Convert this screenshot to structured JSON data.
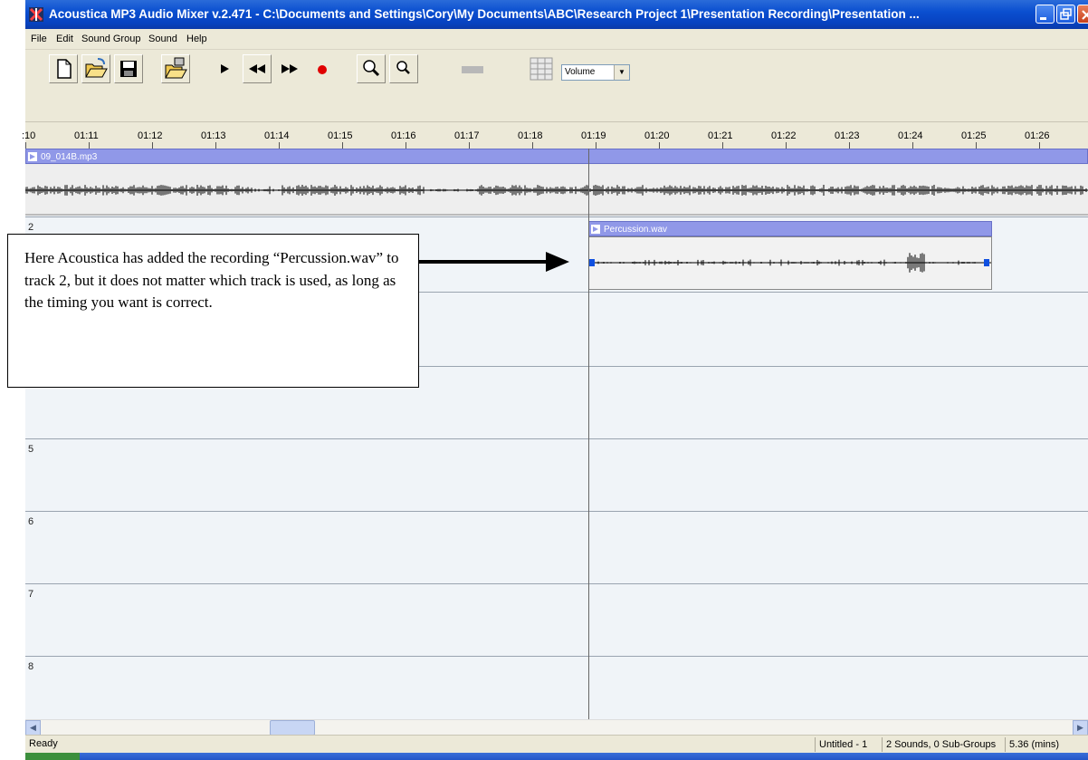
{
  "window": {
    "title": "Acoustica MP3 Audio Mixer v.2.471 - C:\\Documents and Settings\\Cory\\My Documents\\ABC\\Research Project 1\\Presentation Recording\\Presentation ..."
  },
  "menu": [
    "File",
    "Edit",
    "Sound Group",
    "Sound",
    "Help"
  ],
  "toolbar": {
    "buttons": [
      "new-file-icon",
      "open-folder-icon",
      "save-icon",
      "open-project-icon",
      "play-icon",
      "rewind-icon",
      "fast-forward-icon",
      "record-icon",
      "zoom-in-icon",
      "zoom-out-icon",
      "mute-icon",
      "grid-icon"
    ],
    "volume_label": "Volume"
  },
  "ruler": {
    "ticks": [
      ":10",
      "01:11",
      "01:12",
      "01:13",
      "01:14",
      "01:15",
      "01:16",
      "01:17",
      "01:18",
      "01:19",
      "01:20",
      "01:21",
      "01:22",
      "01:23",
      "01:24",
      "01:25",
      "01:26"
    ]
  },
  "tracks": {
    "numbers": [
      "2",
      "5",
      "6",
      "7",
      "8"
    ],
    "clip1_name": "09_014B.mp3",
    "clip2_name": "Percussion.wav"
  },
  "callout": {
    "text": "Here Acoustica has added the recording “Percussion.wav” to track 2, but it does not matter which track is used, as long as the timing you want is correct."
  },
  "status": {
    "ready": "Ready",
    "document": "Untitled - 1",
    "sounds": "2 Sounds, 0 Sub-Groups",
    "length": "5.36 (mins)"
  },
  "colors": {
    "titlebar": "#0a4fd0",
    "clip_header": "#9098e8",
    "record": "#e00000"
  }
}
